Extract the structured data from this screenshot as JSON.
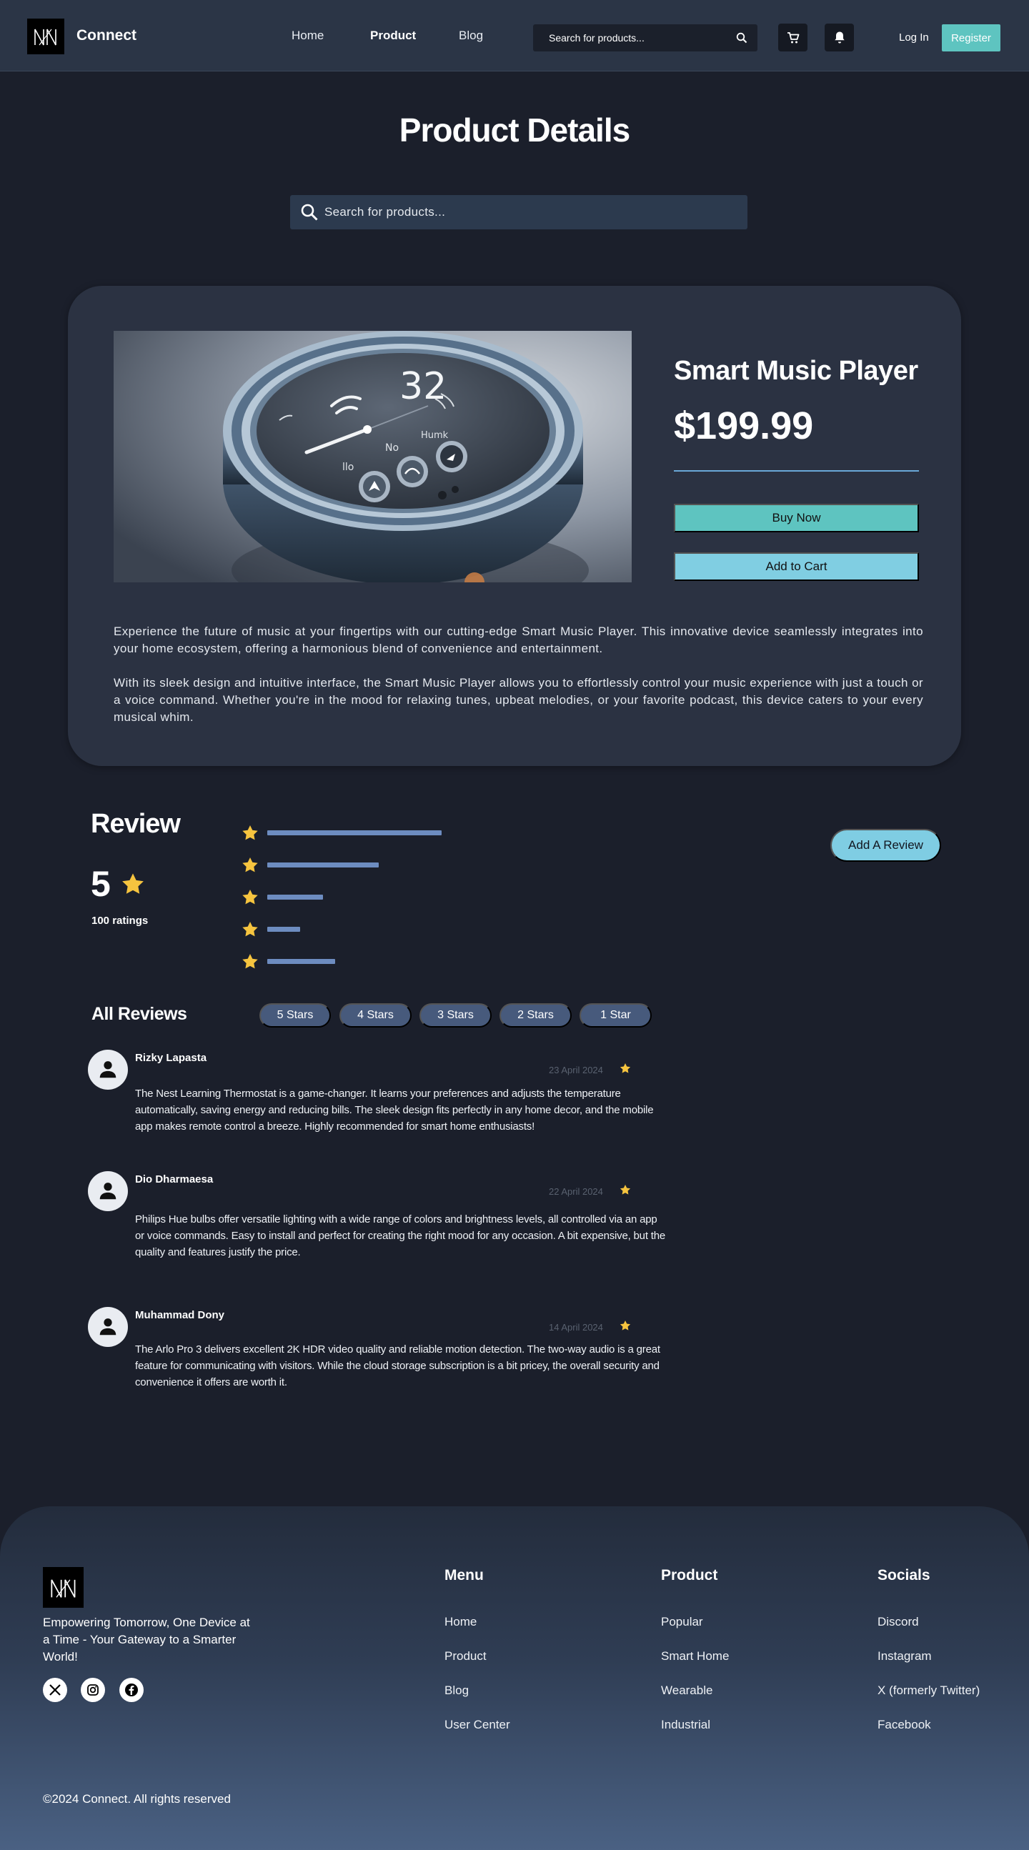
{
  "nav": {
    "brand": "Connect",
    "links": [
      "Home",
      "Product",
      "Blog"
    ],
    "active_link": "Product",
    "search_placeholder": "Search for products...",
    "login": "Log In",
    "register": "Register"
  },
  "page": {
    "title": "Product Details",
    "search_placeholder": "Search for products..."
  },
  "product": {
    "name": "Smart Music Player",
    "price": "$199.99",
    "buy_now": "Buy Now",
    "add_to_cart": "Add to Cart",
    "description": [
      "Experience the future of music at  your fingertips with our cutting-edge Smart Music Player. This  innovative device seamlessly integrates into your home ecosystem,  offering a harmonious blend of convenience and entertainment.",
      "With its sleek design and intuitive  interface, the Smart Music Player allows you to effortlessly control  your music experience with just a touch or a voice command. Whether  you're in the mood for relaxing tunes, upbeat melodies, or your favorite  podcast, this device caters to your every musical whim."
    ],
    "device_display": {
      "number": "32",
      "labels": [
        "llo",
        "No",
        "Humk"
      ]
    }
  },
  "review_summary": {
    "title": "Review",
    "average": "5",
    "ratings_count": "100 ratings",
    "add_review": "Add A Review",
    "distribution": [
      {
        "stars": 5,
        "fraction": 1.0
      },
      {
        "stars": 4,
        "fraction": 0.64
      },
      {
        "stars": 3,
        "fraction": 0.32
      },
      {
        "stars": 2,
        "fraction": 0.19
      },
      {
        "stars": 1,
        "fraction": 0.39
      }
    ]
  },
  "all_reviews": {
    "title": "All Reviews",
    "filters": [
      "5 Stars",
      "4 Stars",
      "3 Stars",
      "2 Stars",
      "1 Star"
    ],
    "items": [
      {
        "name": "Rizky Lapasta",
        "date": "23 April 2024",
        "text": "The Nest Learning Thermostat is a game-changer. It learns your preferences and adjusts the temperature automatically, saving energy and reducing bills. The sleek design fits perfectly in any home decor, and the mobile app makes remote control a breeze. Highly recommended for smart home enthusiasts!"
      },
      {
        "name": "Dio Dharmaesa",
        "date": "22 April 2024",
        "text": "Philips Hue bulbs offer versatile lighting with a wide range of colors and brightness levels, all controlled via an app or voice commands. Easy to install and perfect for creating the right mood for any occasion. A bit expensive, but the quality and features justify the price."
      },
      {
        "name": "Muhammad Dony",
        "date": "14 April 2024",
        "text": "The Arlo Pro 3 delivers excellent 2K HDR video quality and reliable motion detection. The two-way audio is a great feature for communicating with visitors. While the cloud storage subscription is a bit pricey, the overall security and convenience it offers are worth it."
      }
    ]
  },
  "footer": {
    "tagline": "Empowering Tomorrow, One Device at a Time - Your Gateway to a Smarter World!",
    "columns": [
      {
        "title": "Menu",
        "links": [
          "Home",
          "Product",
          "Blog",
          "User Center"
        ]
      },
      {
        "title": "Product",
        "links": [
          "Popular",
          "Smart Home",
          "Wearable",
          "Industrial"
        ]
      },
      {
        "title": "Socials",
        "links": [
          "Discord",
          "Instagram",
          "X (formerly Twitter)",
          "Facebook"
        ]
      }
    ],
    "copyright": "©2024 Connect. All rights reserved"
  },
  "colors": {
    "background": "#1b1f2b",
    "navbar": "#2b3546",
    "accent_teal": "#5ec4c0",
    "accent_light_blue": "#80cee2",
    "star": "#f6c43f",
    "bar": "#6d8cc0",
    "pill": "#475a7c"
  },
  "icons": [
    "logo-mark",
    "search-icon",
    "cart-icon",
    "bell-icon",
    "star-icon",
    "user-icon",
    "x-icon",
    "instagram-icon",
    "facebook-icon"
  ]
}
